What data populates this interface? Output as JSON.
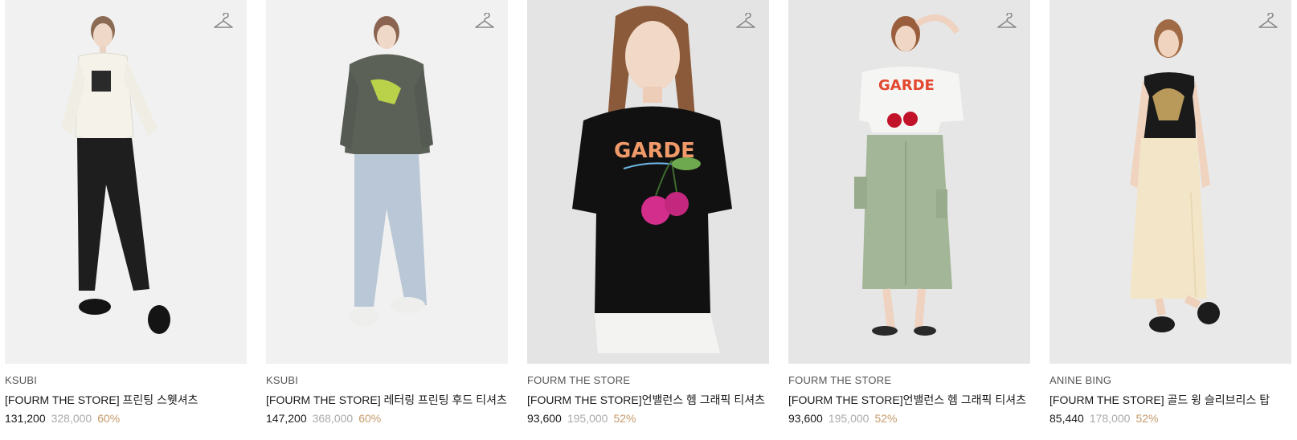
{
  "products": [
    {
      "brand": "KSUBI",
      "name": "[FOURM THE STORE] 프린팅 스웻셔츠",
      "price": "131,200",
      "original_price": "328,000",
      "discount": "60%",
      "image_bg": "#f1f1f1",
      "top_color": "#f4f2e9",
      "bottom_color": "#1e1e1e",
      "icon": "hanger-icon"
    },
    {
      "brand": "KSUBI",
      "name": "[FOURM THE STORE] 레터링 프린팅 후드 티셔츠",
      "price": "147,200",
      "original_price": "368,000",
      "discount": "60%",
      "image_bg": "#f1f1f1",
      "top_color": "#5c6158",
      "bottom_color": "#b9c7d6",
      "icon": "hanger-icon"
    },
    {
      "brand": "FOURM THE STORE",
      "name": "[FOURM THE STORE]언밸런스 헴 그래픽 티셔츠",
      "price": "93,600",
      "original_price": "195,000",
      "discount": "52%",
      "image_bg": "#e4e4e4",
      "top_color": "#111111",
      "bottom_color": "#f3f3f1",
      "icon": "hanger-icon"
    },
    {
      "brand": "FOURM THE STORE",
      "name": "[FOURM THE STORE]언밸런스 헴 그래픽 티셔츠",
      "price": "93,600",
      "original_price": "195,000",
      "discount": "52%",
      "image_bg": "#e6e6e6",
      "top_color": "#f5f5f3",
      "bottom_color": "#a3b697",
      "icon": "hanger-icon"
    },
    {
      "brand": "ANINE BING",
      "name": "[FOURM THE STORE] 골드 윙 슬리브리스 탑",
      "price": "85,440",
      "original_price": "178,000",
      "discount": "52%",
      "image_bg": "#e9e9e9",
      "top_color": "#1a1a1a",
      "bottom_color": "#f3e6c8",
      "icon": "hanger-icon"
    }
  ]
}
